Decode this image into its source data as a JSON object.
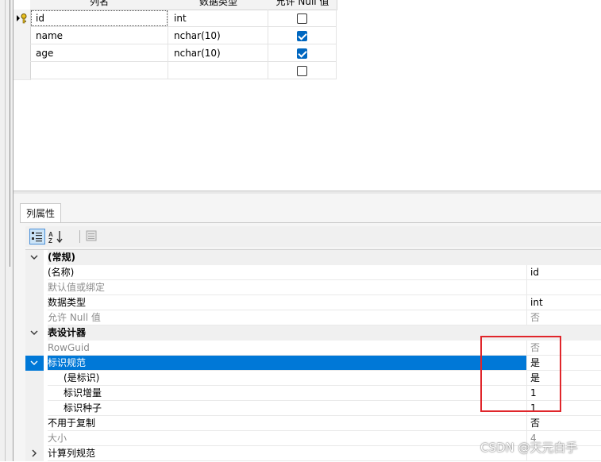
{
  "grid": {
    "headers": [
      "列名",
      "数据类型",
      "允许 Null 值"
    ],
    "rows": [
      {
        "name": "id",
        "type": "int",
        "allow_null": false,
        "primary_key": true
      },
      {
        "name": "name",
        "type": "nchar(10)",
        "allow_null": true,
        "primary_key": false
      },
      {
        "name": "age",
        "type": "nchar(10)",
        "allow_null": true,
        "primary_key": false
      },
      {
        "name": "",
        "type": "",
        "allow_null": false,
        "primary_key": false
      }
    ]
  },
  "props": {
    "tab": "列属性",
    "rows": [
      {
        "kind": "cat",
        "label": "(常规)",
        "value": "",
        "state": "expanded"
      },
      {
        "kind": "item",
        "label": "(名称)",
        "value": "id"
      },
      {
        "kind": "dim",
        "label": "默认值或绑定",
        "value": ""
      },
      {
        "kind": "item",
        "label": "数据类型",
        "value": "int"
      },
      {
        "kind": "dim",
        "label": "允许 Null 值",
        "value": "否"
      },
      {
        "kind": "cat",
        "label": "表设计器",
        "value": "",
        "state": "expanded"
      },
      {
        "kind": "dim",
        "label": "RowGuid",
        "value": "否"
      },
      {
        "kind": "sel",
        "label": "标识规范",
        "value": "是",
        "state": "expanded"
      },
      {
        "kind": "sub",
        "label": "(是标识)",
        "value": "是"
      },
      {
        "kind": "sub",
        "label": "标识增量",
        "value": "1"
      },
      {
        "kind": "sub",
        "label": "标识种子",
        "value": "1"
      },
      {
        "kind": "item",
        "label": "不用于复制",
        "value": "否"
      },
      {
        "kind": "dim",
        "label": "大小",
        "value": "4"
      },
      {
        "kind": "item",
        "label": "计算列规范",
        "value": "",
        "state": "collapsed"
      }
    ]
  },
  "watermark": "CSDN @天元白手",
  "colors": {
    "selection": "#0078d7",
    "checkbox": "#0067c0",
    "highlight_box": "#e0262b"
  }
}
